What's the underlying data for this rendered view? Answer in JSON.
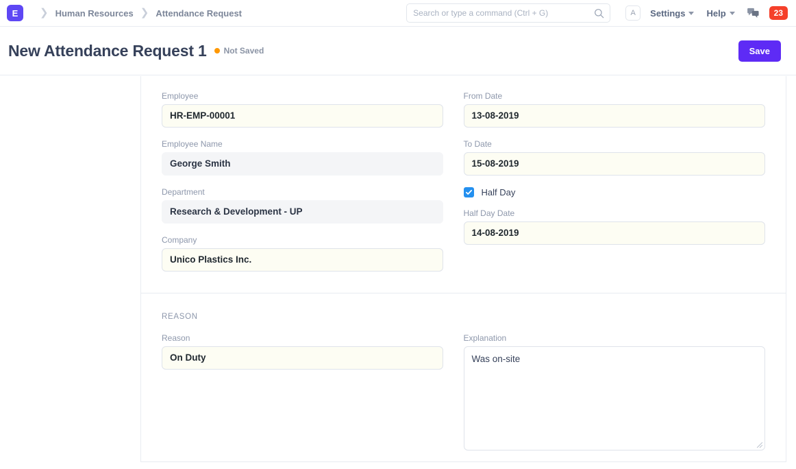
{
  "navbar": {
    "logo_letter": "E",
    "breadcrumbs": [
      {
        "label": "Human Resources"
      },
      {
        "label": "Attendance Request"
      }
    ],
    "search": {
      "placeholder": "Search or type a command (Ctrl + G)",
      "value": ""
    },
    "avatar_letter": "A",
    "settings_label": "Settings",
    "help_label": "Help",
    "notification_count": "23",
    "badge_color": "#f5402a",
    "logo_color": "#5e47f4"
  },
  "titlebar": {
    "title": "New Attendance Request 1",
    "status_text": "Not Saved",
    "status_color": "#ff9800",
    "save_label": "Save",
    "save_color": "#5e2bf5"
  },
  "form": {
    "section_one": {
      "left": [
        {
          "label": "Employee",
          "value": "HR-EMP-00001",
          "type": "editable"
        },
        {
          "label": "Employee Name",
          "value": "George Smith",
          "type": "readonly"
        },
        {
          "label": "Department",
          "value": "Research & Development - UP",
          "type": "readonly"
        },
        {
          "label": "Company",
          "value": "Unico Plastics Inc.",
          "type": "editable"
        }
      ],
      "right": {
        "from_date": {
          "label": "From Date",
          "value": "13-08-2019"
        },
        "to_date": {
          "label": "To Date",
          "value": "15-08-2019"
        },
        "half_day": {
          "label": "Half Day",
          "checked": true,
          "color": "#2490ef"
        },
        "half_day_date": {
          "label": "Half Day Date",
          "value": "14-08-2019"
        }
      }
    },
    "section_two": {
      "heading": "REASON",
      "reason": {
        "label": "Reason",
        "value": "On Duty"
      },
      "explanation": {
        "label": "Explanation",
        "value": "Was on-site"
      }
    }
  }
}
